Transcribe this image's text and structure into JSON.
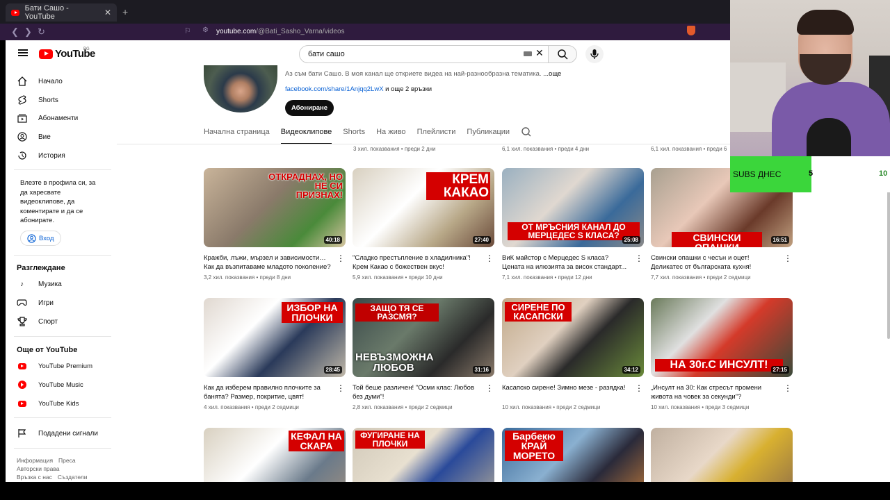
{
  "browser": {
    "tab_title": "Бати Сашо - YouTube",
    "url_host": "youtube.com",
    "url_path": "/@Bati_Sasho_Varna/videos"
  },
  "youtube": {
    "logo_text": "YouTube",
    "country_code": "BG",
    "search_query": "бати сашо"
  },
  "sidebar": {
    "items": [
      {
        "label": "Начало",
        "icon": "home-icon"
      },
      {
        "label": "Shorts",
        "icon": "shorts-icon"
      },
      {
        "label": "Абонаменти",
        "icon": "subscriptions-icon"
      },
      {
        "label": "Вие",
        "icon": "you-icon"
      },
      {
        "label": "История",
        "icon": "history-icon"
      }
    ],
    "signin_text": "Влезте в профила си, за да харесвате видеоклипове, да коментирате и да се абонирате.",
    "signin_button": "Вход",
    "explore_title": "Разглеждане",
    "explore_items": [
      {
        "label": "Музика",
        "icon": "music-icon"
      },
      {
        "label": "Игри",
        "icon": "games-icon"
      },
      {
        "label": "Спорт",
        "icon": "sport-icon"
      }
    ],
    "more_title": "Още от YouTube",
    "more_items": [
      {
        "label": "YouTube Premium"
      },
      {
        "label": "YouTube Music"
      },
      {
        "label": "YouTube Kids"
      }
    ],
    "report": "Подадени сигнали",
    "footer_row1": [
      "Информация",
      "Преса"
    ],
    "footer_row2": [
      "Авторски права"
    ],
    "footer_row3": [
      "Връзка с нас",
      "Създатели"
    ]
  },
  "channel": {
    "description": "Аз съм бати Сашо. В моя канал ще откриете видеа на най-разнообразна тематика. ",
    "more": "...още",
    "link": "facebook.com/share/1Anjqq2LwX",
    "link_more": " и още 2 връзки",
    "subscribe": "Абониране",
    "tabs": [
      "Начална страница",
      "Видеоклипове",
      "Shorts",
      "На живо",
      "Плейлисти",
      "Публикации"
    ],
    "active_tab": "Видеоклипове"
  },
  "top_row_meta": [
    "3 хил. показвания • преди 2 дни",
    "6,1 хил. показвания • преди 4 дни",
    "6,1 хил. показвания • преди 6"
  ],
  "videos": [
    {
      "title": "Кражби, лъжи, мързел и зависимости… Как да възпитаваме младото поколение?",
      "views": "3,2 хил. показвания",
      "age": "преди 8 дни",
      "duration": "40:18",
      "overlay": "ОТКРАДНАХ, НО НЕ СИ ПРИЗНАХ!"
    },
    {
      "title": "\"Сладко престъпление в хладилника\"! Крем Какао с божествен вкус!",
      "views": "5,9 хил. показвания",
      "age": "преди 10 дни",
      "duration": "27:40",
      "overlay": "КРЕМ КАКАО"
    },
    {
      "title": "ВиК майстор с Мерцедес S класа? Цената на илюзията за висок стандарт...",
      "views": "7,1 хил. показвания",
      "age": "преди 12 дни",
      "duration": "25:08",
      "overlay": "ОТ МРЪСНИЯ КАНАЛ ДО МЕРЦЕДЕС S КЛАСА?"
    },
    {
      "title": "Свински опашки с чесън и оцет! Деликатес от българската кухня!",
      "views": "7,7 хил. показвания",
      "age": "преди 2 седмици",
      "duration": "16:51",
      "overlay": "СВИНСКИ ОПАШКИ"
    },
    {
      "title": "Как да изберем правилно плочките за банята? Размер, покритие, цвят!",
      "views": "4 хил. показвания",
      "age": "преди 2 седмици",
      "duration": "28:45",
      "overlay": "ИЗБОР НА ПЛОЧКИ"
    },
    {
      "title": "Той беше различен! \"Осми клас: Любов без думи\"!",
      "views": "2,8 хил. показвания",
      "age": "преди 2 седмици",
      "duration": "31:16",
      "overlay": "ЗАЩО ТЯ СЕ РАЗСМЯ?"
    },
    {
      "title": "Касапско сирене! Зимно мезе - разядка!",
      "views": "10 хил. показвания",
      "age": "преди 2 седмици",
      "duration": "34:12",
      "overlay": "СИРЕНЕ ПО КАСАПСКИ"
    },
    {
      "title": "„Инсулт на 30: Как стресът промени живота на човек за секунди\"?",
      "views": "10 хил. показвания",
      "age": "преди 3 седмици",
      "duration": "27:15",
      "overlay": "НА 30г.С ИНСУЛТ!"
    },
    {
      "title": "",
      "views": "",
      "age": "",
      "duration": "",
      "overlay": "КЕФАЛ НА СКАРА"
    },
    {
      "title": "",
      "views": "",
      "age": "",
      "duration": "",
      "overlay": "ФУГИРАНЕ НА ПЛОЧКИ"
    },
    {
      "title": "",
      "views": "",
      "age": "",
      "duration": "",
      "overlay": "Барбекю КРАЙ МОРЕТО"
    },
    {
      "title": "",
      "views": "",
      "age": "",
      "duration": "",
      "overlay": ""
    }
  ],
  "extra_overlay": "НЕВЪЗМОЖНА ЛЮБОВ",
  "subs_widget": {
    "label": "SUBS ДНЕС",
    "current": "5",
    "goal": "10",
    "progress": 0.5,
    "fill_color": "#3bd63b"
  }
}
